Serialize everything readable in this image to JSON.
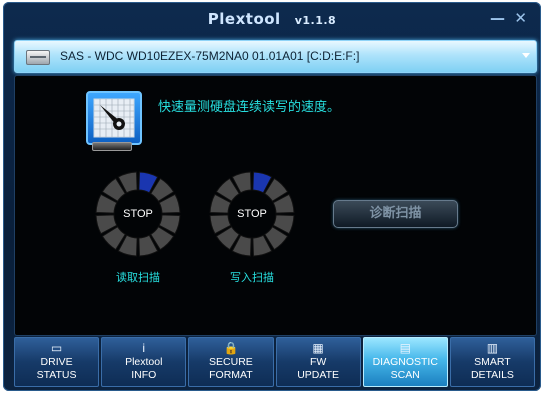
{
  "window": {
    "title": "Plextool",
    "version": "v1.1.8",
    "minimize_glyph": "—",
    "close_glyph": "✕"
  },
  "drive": {
    "label": "SAS   - WDC WD10EZEX-75M2NA0 01.01A01 [C:D:E:F:]",
    "icon": "hard-drive-icon"
  },
  "main": {
    "headline": "快速量测硬盘连续读写的速度。",
    "read_scan": {
      "status": "STOP",
      "label": "读取扫描",
      "progress": 0
    },
    "write_scan": {
      "status": "STOP",
      "label": "写入扫描",
      "progress": 0
    },
    "diagnose_button": "诊断扫描",
    "colors": {
      "accent": "#27e0e0",
      "ring_active": "#1a36b0",
      "ring_idle": "#4a4a4a"
    }
  },
  "tabs": [
    {
      "label": "DRIVE\nSTATUS",
      "icon": "monitor-icon",
      "glyph": "▭",
      "active": false
    },
    {
      "label": "Plextool\nINFO",
      "icon": "info-icon",
      "glyph": "i",
      "active": false
    },
    {
      "label": "SECURE\nFORMAT",
      "icon": "lock-icon",
      "glyph": "🔒",
      "active": false
    },
    {
      "label": "FW\nUPDATE",
      "icon": "chip-icon",
      "glyph": "▦",
      "active": false
    },
    {
      "label": "DIAGNOSTIC\nSCAN",
      "icon": "diagnostic-icon",
      "glyph": "▤",
      "active": true
    },
    {
      "label": "SMART\nDETAILS",
      "icon": "document-icon",
      "glyph": "▥",
      "active": false
    }
  ]
}
